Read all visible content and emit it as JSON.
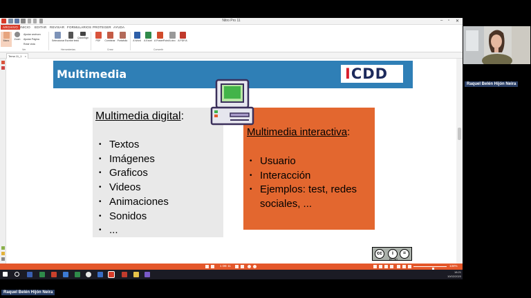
{
  "app": {
    "title": "Nitro Pro 11",
    "menu": [
      "ARCHIVO",
      "INICIO",
      "EDITAR",
      "REVISAR",
      "FORMULARIOS",
      "PROTEGER",
      "AYUDA"
    ],
    "ribbon": {
      "buttons": [
        "Mano",
        "Zoom",
        "Seleccionar",
        "Escribir texto",
        "QuickSign",
        "PDF",
        "Combinar",
        "Portafolio",
        "A Word",
        "A Excel",
        "A PowerPoint",
        "A otro",
        "A PDF/A"
      ],
      "small_items": [
        "Ajustar anchura",
        "Ajustar Página",
        "Rotar vista"
      ],
      "groups": [
        "Ver",
        "Herramientas",
        "Crear",
        "Convertir"
      ]
    },
    "doc_tab": "Tema 11_1",
    "statusbar": {
      "page_text": "1 DE 11",
      "zoom_text": "134%",
      "zoom_level": 0.6
    }
  },
  "slide": {
    "title": "Multimedia",
    "logo": {
      "part1": "I",
      "part2": "CDD"
    },
    "left_box": {
      "title_underlined": "Multimedia digital",
      "title_suffix": ":",
      "items": [
        "Textos",
        "Imágenes",
        "Graficos",
        "Videos",
        "Animaciones",
        "Sonidos",
        "..."
      ]
    },
    "right_box": {
      "title_underlined": "Multimedia interactiva",
      "title_suffix": ":",
      "items": [
        "Usuario",
        "Interacción",
        "Ejemplos: test, redes sociales, ..."
      ]
    },
    "license": {
      "symbols": [
        "cc",
        "i",
        "="
      ],
      "label": "BY  ND"
    }
  },
  "taskbar": {
    "time": "18:21",
    "date": "10/02/2020"
  },
  "participant": {
    "name": "Raquel Belén Hijón Neira",
    "presenter_label": "Raquel Belén Hijón Neira"
  },
  "colors": {
    "accent_red": "#d73b2a",
    "status_orange": "#e4572a",
    "slide_blue": "#2f7fb6",
    "box_orange": "#e3672f"
  }
}
